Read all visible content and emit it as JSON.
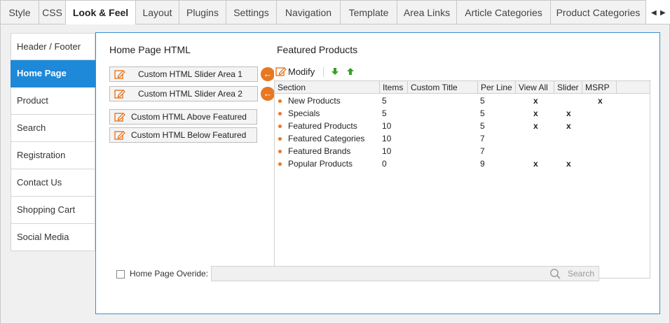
{
  "tabs": [
    {
      "label": "Style",
      "active": false
    },
    {
      "label": "CSS",
      "active": false
    },
    {
      "label": "Look & Feel",
      "active": true
    },
    {
      "label": "Layout",
      "active": false
    },
    {
      "label": "Plugins",
      "active": false
    },
    {
      "label": "Settings",
      "active": false
    },
    {
      "label": "Navigation",
      "active": false
    },
    {
      "label": "Template",
      "active": false
    },
    {
      "label": "Area Links",
      "active": false
    },
    {
      "label": "Article Categories",
      "active": false
    },
    {
      "label": "Product Categories",
      "active": false
    }
  ],
  "tab_scroll": {
    "left": "◀",
    "right": "▶"
  },
  "sidebar": {
    "items": [
      {
        "label": "Header / Footer",
        "active": false
      },
      {
        "label": "Home Page",
        "active": true
      },
      {
        "label": "Product",
        "active": false
      },
      {
        "label": "Search",
        "active": false
      },
      {
        "label": "Registration",
        "active": false
      },
      {
        "label": "Contact Us",
        "active": false
      },
      {
        "label": "Shopping Cart",
        "active": false
      },
      {
        "label": "Social Media",
        "active": false
      }
    ]
  },
  "home_html": {
    "title": "Home Page HTML",
    "buttons": [
      {
        "label": "Custom HTML Slider Area 1",
        "icon": "pencil-edit-icon"
      },
      {
        "label": "Custom HTML Slider Area 2",
        "icon": "pencil-edit-icon"
      },
      {
        "label": "Custom HTML Above Featured",
        "icon": "pencil-edit-icon"
      },
      {
        "label": "Custom HTML Below Featured",
        "icon": "pencil-edit-icon"
      }
    ],
    "arrow_glyph": "←"
  },
  "featured": {
    "title": "Featured Products",
    "modify_label": "Modify",
    "move_down_glyph": "🡇",
    "move_up_glyph": "🡅",
    "columns": [
      "Section",
      "Items",
      "Custom Title",
      "Per Line",
      "View All",
      "Slider",
      "MSRP"
    ],
    "rows": [
      {
        "section": "New Products",
        "items": "5",
        "custom_title": "",
        "per_line": "5",
        "view_all": "x",
        "slider": "",
        "msrp": "x"
      },
      {
        "section": "Specials",
        "items": "5",
        "custom_title": "",
        "per_line": "5",
        "view_all": "x",
        "slider": "x",
        "msrp": ""
      },
      {
        "section": "Featured Products",
        "items": "10",
        "custom_title": "",
        "per_line": "5",
        "view_all": "x",
        "slider": "x",
        "msrp": ""
      },
      {
        "section": "Featured Categories",
        "items": "10",
        "custom_title": "",
        "per_line": "7",
        "view_all": "",
        "slider": "",
        "msrp": ""
      },
      {
        "section": "Featured Brands",
        "items": "10",
        "custom_title": "",
        "per_line": "7",
        "view_all": "",
        "slider": "",
        "msrp": ""
      },
      {
        "section": "Popular Products",
        "items": "0",
        "custom_title": "",
        "per_line": "9",
        "view_all": "x",
        "slider": "x",
        "msrp": ""
      }
    ]
  },
  "override": {
    "label": "Home Page Overide:",
    "value": "",
    "search_label": "Search"
  },
  "colors": {
    "accent": "#1e88d9",
    "panel_border": "#3a8fd2",
    "orange": "#e87722",
    "green": "#3a9e2a"
  }
}
